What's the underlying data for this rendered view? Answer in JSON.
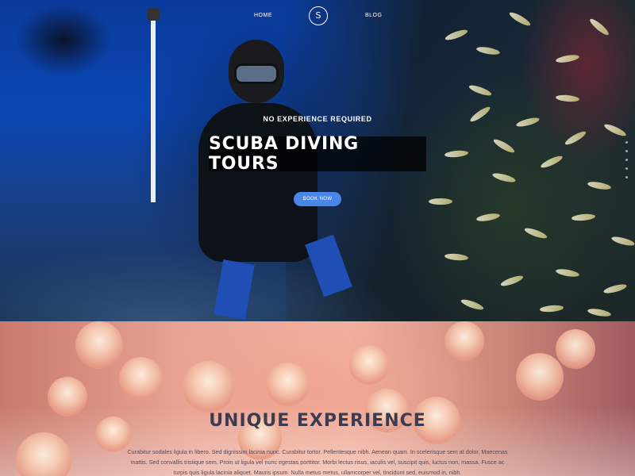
{
  "nav": {
    "home_label": "HOME",
    "blog_label": "BLOG",
    "logo_letter": "S"
  },
  "hero": {
    "subtitle": "NO EXPERIENCE REQUIRED",
    "title": "SCUBA DIVING TOURS",
    "button_label": "BOOK NOW",
    "slide_count": 5
  },
  "section": {
    "title": "UNIQUE EXPERIENCE",
    "text": "Curabitur sodales ligula in libero. Sed dignissim lacinia nunc. Curabitur tortor. Pellentesque nibh. Aenean quam. In scelerisque sem at dolor. Maecenas mattis. Sed convallis tristique sem. Proin ut ligula vel nunc egestas porttitor. Morbi lectus risus, iaculis vel, suscipit quis, luctus non, massa. Fusce ac turpis quis ligula lacinia aliquet. Mauris ipsum. Nulla metus metus, ullamcorper vel, tincidunt sed, euismod in, nibh."
  },
  "colors": {
    "accent_button": "#4a86e8",
    "title_box": "#000000",
    "section_title": "#3b3b52"
  },
  "icons": {
    "logo": "letter-s-circle-icon"
  }
}
